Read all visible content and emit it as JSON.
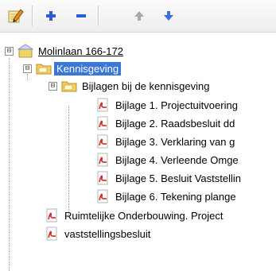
{
  "toolbar": {
    "buttons": [
      {
        "name": "edit",
        "icon": "pencil-notepad-icon"
      },
      {
        "name": "add",
        "icon": "plus-icon"
      },
      {
        "name": "remove",
        "icon": "minus-icon"
      },
      {
        "name": "move-up",
        "icon": "arrow-up-icon"
      },
      {
        "name": "move-down",
        "icon": "arrow-down-icon"
      }
    ]
  },
  "tree": {
    "root": {
      "label": "Molinlaan 166-172",
      "expander": "⊟"
    },
    "kennisgeving": {
      "label": "Kennisgeving",
      "expander": "⊟"
    },
    "bijlagen": {
      "label": "Bijlagen bij de kennisgeving",
      "expander": "⊟"
    },
    "attachments": [
      "Bijlage 1. Projectuitvoering",
      "Bijlage 2. Raadsbesluit dd",
      "Bijlage 3. Verklaring van g",
      "Bijlage 4. Verleende Omge",
      "Bijlage 5. Besluit Vaststellin",
      "Bijlage 6. Tekening plange"
    ],
    "root_documents": [
      "Ruimtelijke Onderbouwing. Project",
      "vaststellingsbesluit"
    ]
  },
  "colors": {
    "selection": "#3a77d6",
    "toolbar_plus_minus": "#2b5bd6",
    "arrow_up": "#a9a9a9",
    "arrow_down": "#3c6ee0",
    "pdf_red": "#d22a2a"
  }
}
